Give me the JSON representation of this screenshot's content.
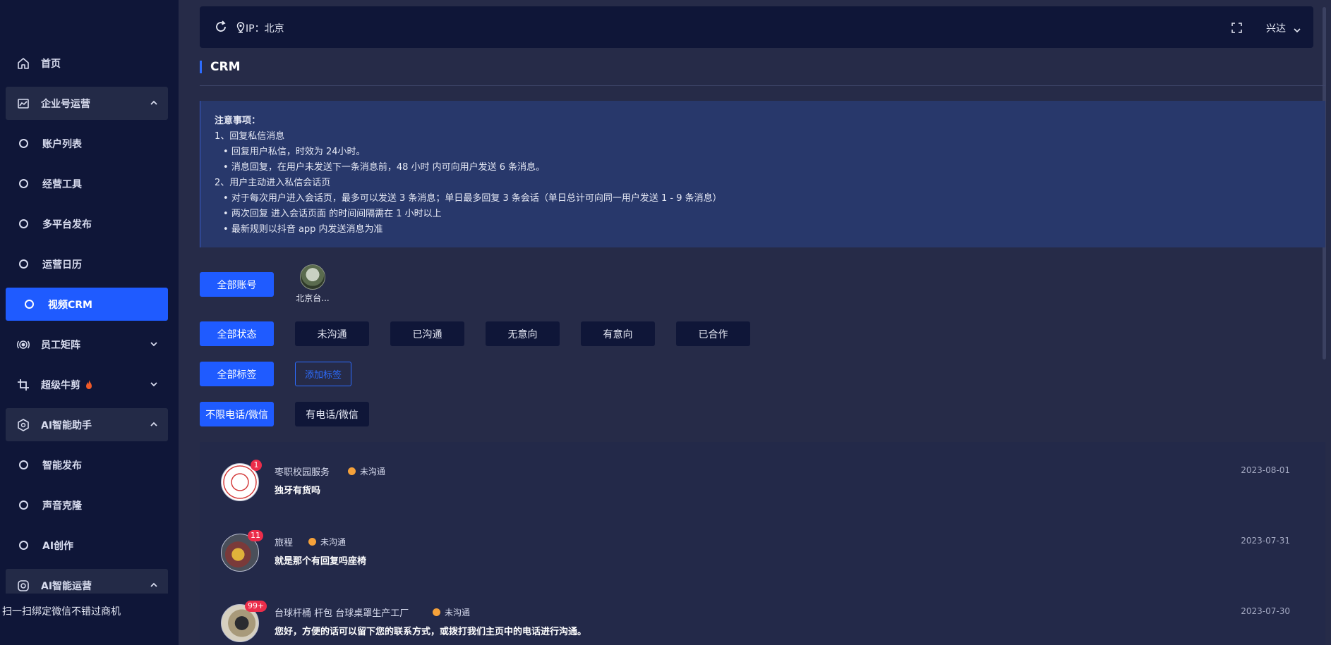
{
  "sidebar": {
    "items": [
      {
        "label": "首页",
        "icon": "home-icon",
        "type": "top"
      },
      {
        "label": "企业号运营",
        "icon": "chart-icon",
        "type": "group",
        "expanded": true
      },
      {
        "label": "账户列表",
        "type": "sub"
      },
      {
        "label": "经营工具",
        "type": "sub"
      },
      {
        "label": "多平台发布",
        "type": "sub"
      },
      {
        "label": "运营日历",
        "type": "sub"
      },
      {
        "label": "视频CRM",
        "type": "sub",
        "active": true
      },
      {
        "label": "员工矩阵",
        "icon": "broadcast-icon",
        "type": "top",
        "expanded": false
      },
      {
        "label": "超级牛剪",
        "icon": "crop-icon",
        "type": "top",
        "expanded": false,
        "hot": true
      },
      {
        "label": "AI智能助手",
        "icon": "ai-icon",
        "type": "group",
        "expanded": true
      },
      {
        "label": "智能发布",
        "type": "sub"
      },
      {
        "label": "声音克隆",
        "type": "sub"
      },
      {
        "label": "AI创作",
        "type": "sub"
      },
      {
        "label": "AI智能运营",
        "icon": "ai-ops-icon",
        "type": "group",
        "expanded": true
      }
    ],
    "footer": "扫一扫绑定微信不错过商机"
  },
  "topbar": {
    "ip_label": "IP：北京",
    "user": "兴达"
  },
  "page": {
    "title": "CRM"
  },
  "notice": {
    "heading": "注意事项：",
    "sections": [
      {
        "title": "1、回复私信消息",
        "bullets": [
          "回复用户私信，时效为 24小时。",
          "消息回复，在用户未发送下一条消息前，48 小时 内可向用户发送 6 条消息。"
        ]
      },
      {
        "title": "2、用户主动进入私信会话页",
        "bullets": [
          "对于每次用户进入会话页，最多可以发送 3 条消息；单日最多回复 3 条会话（单日总计可向同一用户发送 1 - 9 条消息）",
          "两次回复 进入会话页面 的时间间隔需在 1 小时以上",
          "最新规则以抖音 app 内发送消息为准"
        ]
      }
    ]
  },
  "filters": {
    "all_accounts": "全部账号",
    "account_name": "北京台...",
    "all_status": "全部状态",
    "statuses": [
      "未沟通",
      "已沟通",
      "无意向",
      "有意向",
      "已合作"
    ],
    "all_tags": "全部标签",
    "add_tag": "添加标签",
    "phone_any": "不限电话/微信",
    "phone_has": "有电话/微信"
  },
  "conversations": [
    {
      "name": "枣职校园服务",
      "status": "未沟通",
      "message": "独牙有货吗",
      "date": "2023-08-01",
      "badge": "1",
      "status_color": "#f5a13a"
    },
    {
      "name": "旅程",
      "status": "未沟通",
      "message": "就是那个有回复吗座椅",
      "date": "2023-07-31",
      "badge": "11",
      "status_color": "#f5a13a"
    },
    {
      "name": "台球杆桶 杆包 台球桌罩生产工厂",
      "status": "未沟通",
      "message": "您好，方便的话可以留下您的联系方式，或拨打我们主页中的电话进行沟通。",
      "date": "2023-07-30",
      "badge": "99+",
      "status_color": "#f5a13a"
    }
  ]
}
